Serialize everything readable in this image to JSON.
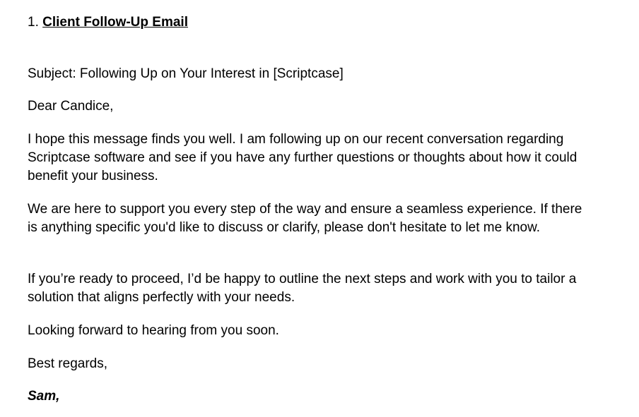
{
  "heading": {
    "number": "1.",
    "title": "Client Follow-Up Email"
  },
  "email": {
    "subject": "Subject: Following Up on Your Interest in [Scriptcase]",
    "greeting": "Dear Candice,",
    "paragraph_1": "I hope this message finds you well. I am following up on our recent conversation regarding Scriptcase software and see if you have any further questions or thoughts about how it could benefit your business.",
    "paragraph_2": "We are here to support you every step of the way and ensure a seamless experience. If there is anything specific you'd like to discuss or clarify, please don't hesitate to let me know.",
    "paragraph_3": "If you’re ready to proceed, I’d be happy to outline the next steps and work with you to tailor a solution that aligns perfectly with your needs.",
    "closing_line": "Looking forward to hearing from you soon.",
    "sign_off": "Best regards,",
    "signature": "Sam,"
  }
}
